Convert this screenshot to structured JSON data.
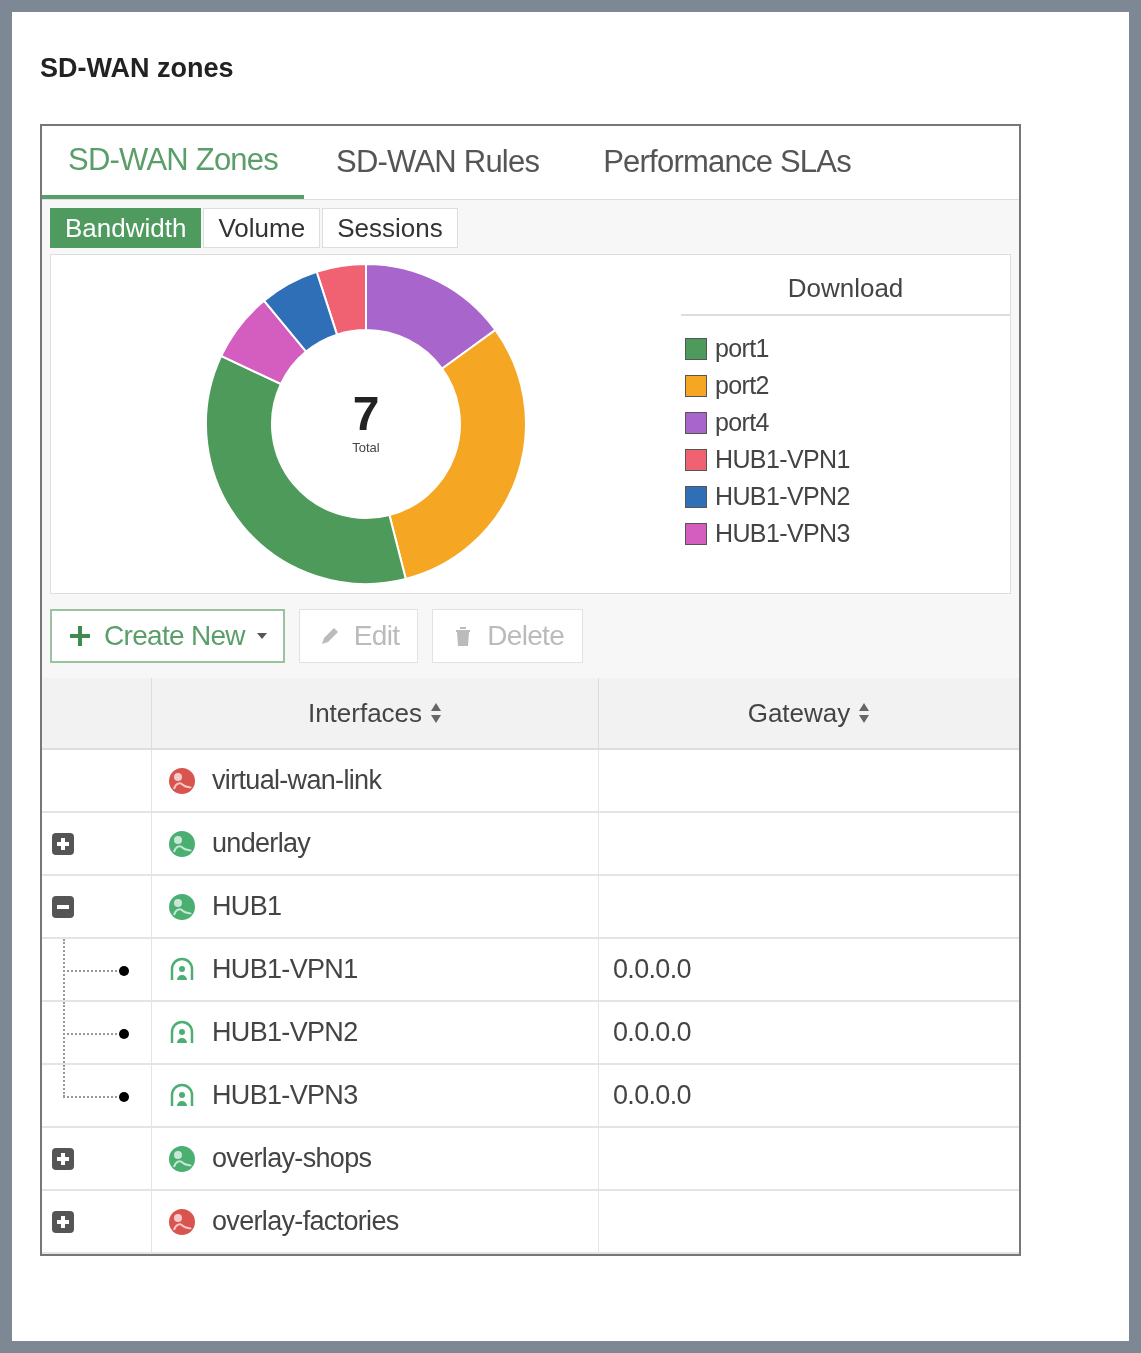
{
  "page_title": "SD-WAN zones",
  "tabs": [
    {
      "label": "SD-WAN Zones",
      "selected": true
    },
    {
      "label": "SD-WAN Rules",
      "selected": false
    },
    {
      "label": "Performance SLAs",
      "selected": false
    }
  ],
  "view_tabs": [
    {
      "label": "Bandwidth",
      "selected": true
    },
    {
      "label": "Volume",
      "selected": false
    },
    {
      "label": "Sessions",
      "selected": false
    }
  ],
  "donut": {
    "total": "7",
    "total_label": "Total",
    "legend_title": "Download",
    "legend": [
      {
        "label": "port1",
        "color": "#4e9a5a"
      },
      {
        "label": "port2",
        "color": "#f5a623"
      },
      {
        "label": "port4",
        "color": "#a866cc"
      },
      {
        "label": "HUB1-VPN1",
        "color": "#f06272"
      },
      {
        "label": "HUB1-VPN2",
        "color": "#2f6fb8"
      },
      {
        "label": "HUB1-VPN3",
        "color": "#d35ec0"
      }
    ]
  },
  "toolbar": [
    {
      "label": "Create New",
      "kind": "create",
      "disabled": false
    },
    {
      "label": "Edit",
      "kind": "edit",
      "disabled": true
    },
    {
      "label": "Delete",
      "kind": "delete",
      "disabled": true
    }
  ],
  "table": {
    "columns": [
      "Interfaces",
      "Gateway"
    ],
    "rows": [
      {
        "name": "virtual-wan-link",
        "kind": "zone",
        "color": "#d9534f"
      },
      {
        "name": "underlay",
        "kind": "zone",
        "color": "#4caf72",
        "expanded": false
      },
      {
        "name": "HUB1",
        "kind": "zone",
        "color": "#4caf72",
        "expanded": true,
        "children": [
          {
            "name": "HUB1-VPN1",
            "kind": "member",
            "gateway": "0.0.0.0"
          },
          {
            "name": "HUB1-VPN2",
            "kind": "member",
            "gateway": "0.0.0.0"
          },
          {
            "name": "HUB1-VPN3",
            "kind": "member",
            "gateway": "0.0.0.0"
          }
        ]
      },
      {
        "name": "overlay-shops",
        "kind": "zone",
        "color": "#4caf72",
        "expanded": false
      },
      {
        "name": "overlay-factories",
        "kind": "zone",
        "color": "#d9534f",
        "expanded": false
      }
    ]
  }
}
